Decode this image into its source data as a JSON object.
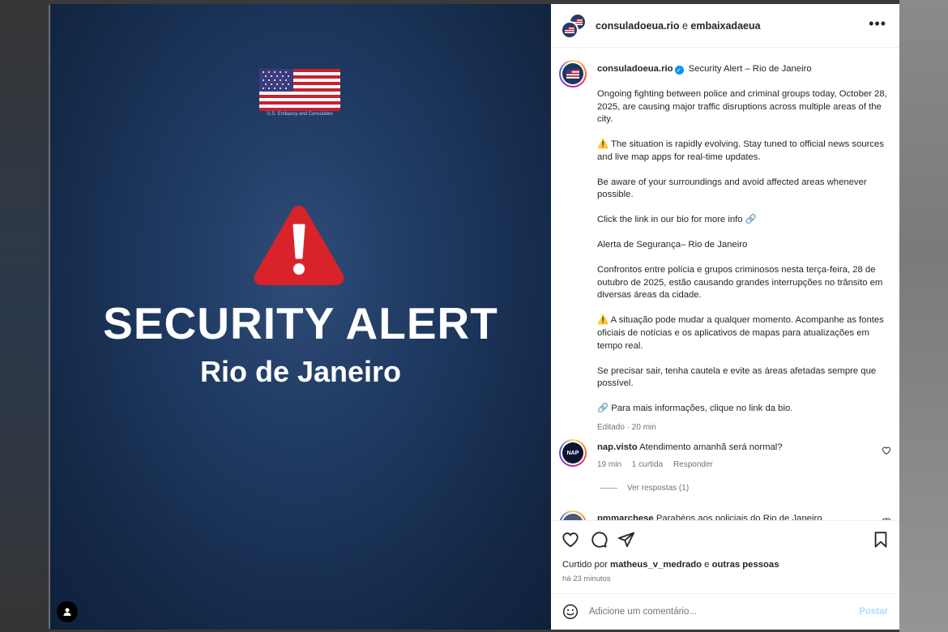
{
  "colors": {
    "media_background": "#1f3a63",
    "alert_red": "#d8232a",
    "verified_blue": "#0095f6",
    "text_primary": "#262626",
    "text_secondary": "#737373",
    "post_button": "#b3dbff"
  },
  "media": {
    "flag_caption": "U.S. Embassy and Consulates",
    "alert_title": "SECURITY ALERT",
    "alert_subtitle": "Rio de Janeiro",
    "icons": [
      "us-flag-icon",
      "warning-triangle-icon",
      "user-tag-icon"
    ]
  },
  "header": {
    "account": "consuladoeua.rio",
    "conjunction": " e ",
    "collaborator": "embaixadaeua",
    "more_icon": "more-options-icon"
  },
  "caption": {
    "username": "consuladoeua.rio",
    "verified_icon": "verified-badge-icon",
    "title": "Security Alert – Rio de Janeiro",
    "p1": "Ongoing fighting between police and criminal groups today, October 28, 2025, are causing major traffic disruptions across multiple areas of the city.",
    "p2": "⚠️ The situation is rapidly evolving. Stay tuned to official news sources and live map apps for real-time updates.",
    "p3": "Be aware of your surroundings and avoid affected areas whenever possible.",
    "p4": "Click the link in our bio for more info 🔗",
    "p5": "Alerta de Segurança– Rio de Janeiro",
    "p6": "Confrontos entre polícia e grupos criminosos nesta terça-feira, 28 de outubro de 2025, estão causando grandes interrupções no trânsito em diversas áreas da cidade.",
    "p7": "⚠️ A situação pode mudar a qualquer momento. Acompanhe as fontes oficiais de notícias e os aplicativos de mapas para atualizações em tempo real.",
    "p8": "Se precisar sair, tenha cautela e evite as áreas afetadas sempre que possível.",
    "p9": "🔗 Para mais informações, clique no link da bio.",
    "meta": "Editado · 20 min"
  },
  "comments": [
    {
      "avatar_text": "NAP",
      "username": "nap.visto",
      "text": "Atendimento amanhã será normal?",
      "time": "19 min",
      "likes": "1 curtida",
      "reply": "Responder",
      "view_replies": "Ver respostas (1)"
    },
    {
      "username": "pmmarchese",
      "text": "Parabéns aos policiais do Rio de Janeiro"
    }
  ],
  "actions": {
    "icons": [
      "heart-icon",
      "comment-icon",
      "share-icon",
      "bookmark-icon"
    ],
    "liked_prefix": "Curtido por ",
    "liked_user": "matheus_v_medrado",
    "liked_suffix": " e ",
    "liked_others": "outras pessoas",
    "time_ago": "há 23 minutos"
  },
  "comment_box": {
    "emoji_icon": "emoji-icon",
    "placeholder": "Adicione um comentário...",
    "post_label": "Postar"
  }
}
